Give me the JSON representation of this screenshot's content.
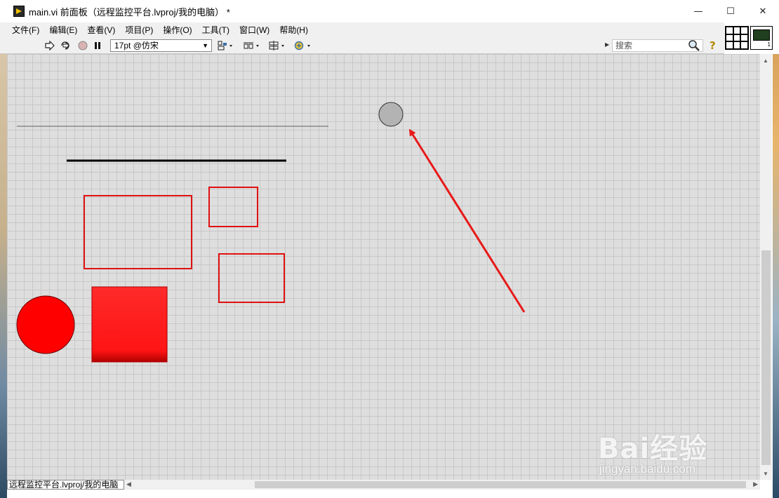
{
  "window": {
    "title": "main.vi 前面板（远程监控平台.lvproj/我的电脑） *",
    "controls": {
      "minimize": "—",
      "maximize": "☐",
      "close": "✕"
    }
  },
  "menu": {
    "items": [
      "文件(F)",
      "编辑(E)",
      "查看(V)",
      "项目(P)",
      "操作(O)",
      "工具(T)",
      "窗口(W)",
      "帮助(H)"
    ]
  },
  "toolbar": {
    "icons": [
      "run-arrow-icon",
      "run-continuously-icon",
      "abort-icon",
      "pause-icon",
      "align-objects-icon",
      "distribute-objects-icon",
      "resize-objects-icon",
      "reorder-icon"
    ],
    "font_select_value": "17pt @仿宋",
    "search_placeholder": "搜索"
  },
  "canvas": {
    "background": "#dedede",
    "grid_color": "#c8c8c8",
    "shapes": [
      {
        "name": "thin-line",
        "kind": "line",
        "color": "#606060"
      },
      {
        "name": "thick-line",
        "kind": "line",
        "color": "#000000"
      },
      {
        "name": "red-rect-large",
        "kind": "rect-outline",
        "color": "#e01010"
      },
      {
        "name": "red-rect-small",
        "kind": "rect-outline",
        "color": "#e01010"
      },
      {
        "name": "red-rect-medium",
        "kind": "rect-outline",
        "color": "#e01010"
      },
      {
        "name": "red-filled-circle",
        "kind": "circle-filled",
        "color": "#ff0000"
      },
      {
        "name": "red-filled-square",
        "kind": "rect-filled",
        "color": "#ff1a1a"
      },
      {
        "name": "gray-circle-indicator",
        "kind": "circle-filled",
        "color": "#b3b3b3"
      },
      {
        "name": "red-annotation-arrow",
        "kind": "arrow",
        "color": "#e81919"
      }
    ]
  },
  "status": {
    "path": "远程监控平台.lvproj/我的电脑"
  },
  "watermark": {
    "brand": "Bai经验",
    "url": "jingyan.baidu.com"
  }
}
